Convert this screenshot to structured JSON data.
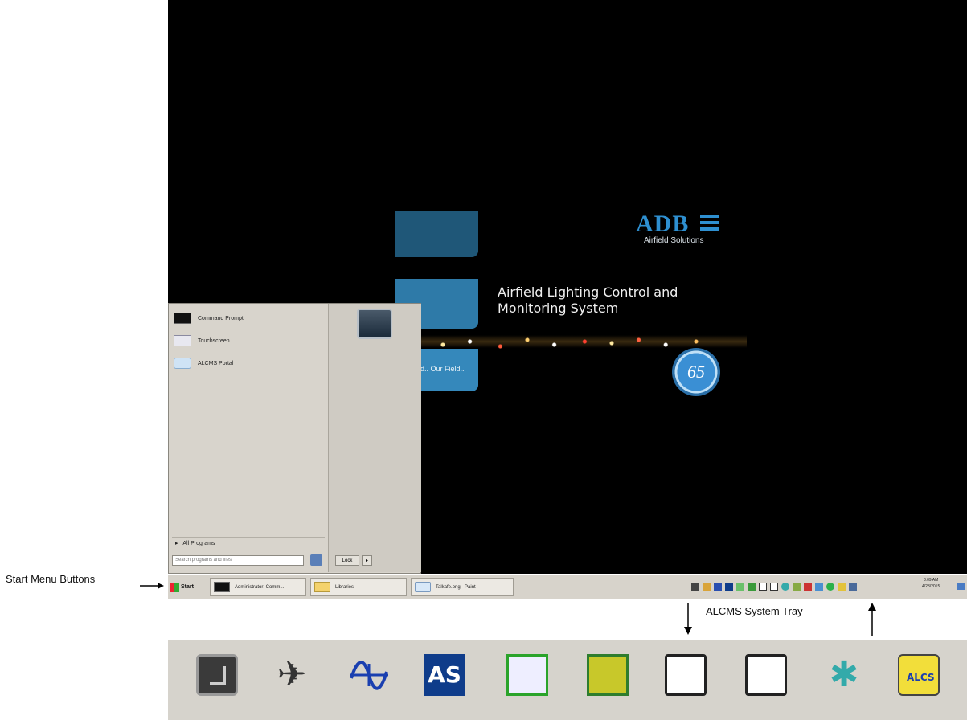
{
  "desktop": {
    "brand": "ADB",
    "brand_sub": "Airfield Solutions",
    "title_line1": "Airfield Lighting Control and",
    "title_line2": "Monitoring System",
    "tile_text": "d.. Our Field..",
    "badge": "65"
  },
  "start_menu": {
    "items": [
      {
        "label": "Command Prompt",
        "icon": "command-prompt-icon"
      },
      {
        "label": "Touchscreen",
        "icon": "touchscreen-icon"
      },
      {
        "label": "ALCMS Portal",
        "icon": "portal-icon"
      }
    ],
    "all_programs": "All Programs",
    "search_placeholder": "Search programs and files",
    "lock_label": "Lock"
  },
  "taskbar": {
    "start_label": "Start",
    "buttons": [
      {
        "label": "Administrator: Comm..."
      },
      {
        "label": "Libraries"
      },
      {
        "label": "Talkafe.png - Paint"
      }
    ],
    "clock_time": "8:09 AM",
    "clock_date": "4/23/2015"
  },
  "annotations": {
    "start_menu_buttons": "Start Menu Buttons",
    "system_tray": "ALCMS System Tray"
  },
  "tray_icons": [
    "monitor-icon",
    "tools-icon",
    "waveform-icon",
    "as-icon",
    "display-icon",
    "map-icon",
    "panel-icon",
    "card-icon",
    "gear-icon",
    "alcs-icon",
    "volume-icon",
    "network-icon",
    "shield-icon",
    "keyboard-icon",
    "app-icon"
  ],
  "colors": {
    "accent": "#2e8fd0",
    "taskbar": "#d7d3cb"
  }
}
